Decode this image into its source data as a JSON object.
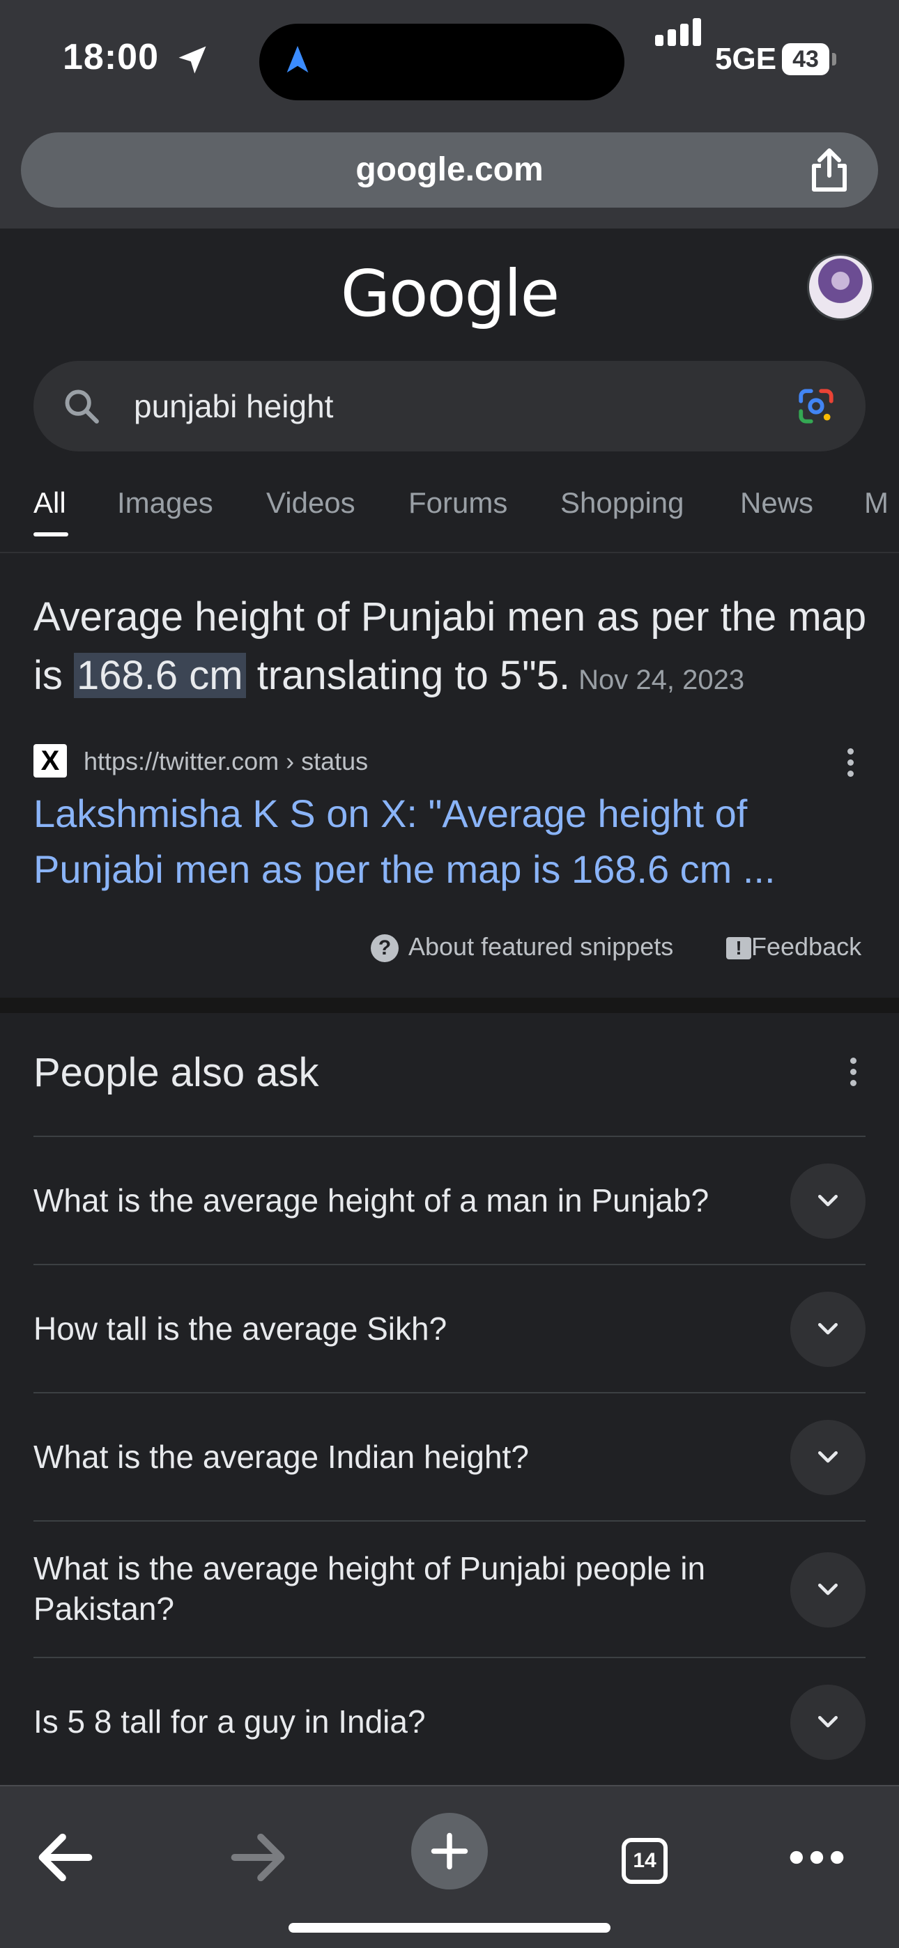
{
  "status_bar": {
    "time": "18:00",
    "network": "5GE",
    "battery": "43"
  },
  "browser": {
    "url": "google.com",
    "open_tabs": "14"
  },
  "google": {
    "logo": "Google",
    "search_query": "punjabi height",
    "tabs": [
      "All",
      "Images",
      "Videos",
      "Forums",
      "Shopping",
      "News",
      "M"
    ]
  },
  "featured_snippet": {
    "text_before": "Average height of Punjabi men as per the map is ",
    "highlight": "168.6 cm",
    "text_after": " translating to 5\"5.",
    "date": "Nov 24, 2023",
    "source_url": "https://twitter.com › status",
    "source_logo": "X",
    "link_title": "Lakshmisha K S on X: \"Average height of Punjabi men as per the map is 168.6 cm ...",
    "about_label": "About featured snippets",
    "feedback_label": "Feedback"
  },
  "people_also_ask": {
    "title": "People also ask",
    "questions": [
      "What is the average height of a man in Punjab?",
      "How tall is the average Sikh?",
      "What is the average Indian height?",
      "What is the average height of Punjabi people in Pakistan?",
      "Is 5 8 tall for a guy in India?"
    ]
  },
  "colors": {
    "background": "#202124",
    "chrome": "#35363a",
    "link": "#8ab4f8",
    "highlight": "#3c4554"
  }
}
